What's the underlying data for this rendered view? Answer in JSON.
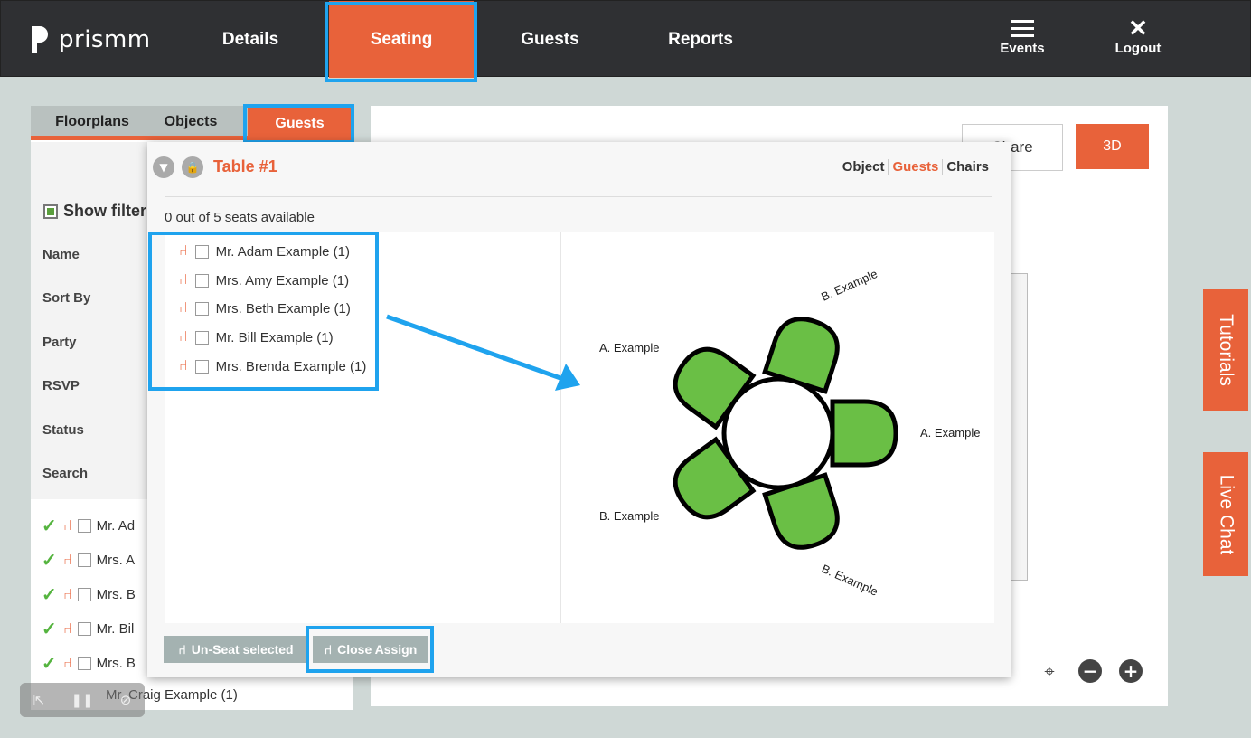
{
  "brand": {
    "name": "prismm"
  },
  "nav": {
    "details": "Details",
    "seating": "Seating",
    "guests": "Guests",
    "reports": "Reports",
    "events": "Events",
    "logout": "Logout"
  },
  "left_panel": {
    "tabs": [
      "Floorplans",
      "Objects",
      "Guests"
    ],
    "show_filters": "Show filter",
    "filters": [
      "Name",
      "Sort By",
      "Party",
      "RSVP",
      "Status",
      "Search"
    ],
    "guests": [
      "Mr. Ad",
      "Mrs. A",
      "Mrs. B",
      "Mr. Bil",
      "Mrs. B",
      "Mr. Craig Example (1)"
    ]
  },
  "canvas": {
    "share": "Share",
    "threed": "3D"
  },
  "side_tabs": {
    "tutorials": "Tutorials",
    "live_chat": "Live Chat"
  },
  "popup": {
    "title": "Table #1",
    "tabs": [
      "Object",
      "Guests",
      "Chairs"
    ],
    "active_tab": "Guests",
    "seats_available": "0 out of 5 seats available",
    "guests": [
      "Mr. Adam Example (1)",
      "Mrs. Amy Example (1)",
      "Mrs. Beth Example (1)",
      "Mr. Bill Example (1)",
      "Mrs. Brenda Example (1)"
    ],
    "unseat": "Un-Seat selected",
    "close_assign": "Close Assign"
  },
  "table_diagram": {
    "labels": [
      "B. Example",
      "A. Example",
      "A. Example",
      "B. Example",
      "B. Example"
    ],
    "chair_color": "#6abf45",
    "table_color": "#ffffff"
  },
  "colors": {
    "accent": "#e8623a",
    "highlight": "#1fa3ee",
    "nav_bg": "#2f3033"
  }
}
